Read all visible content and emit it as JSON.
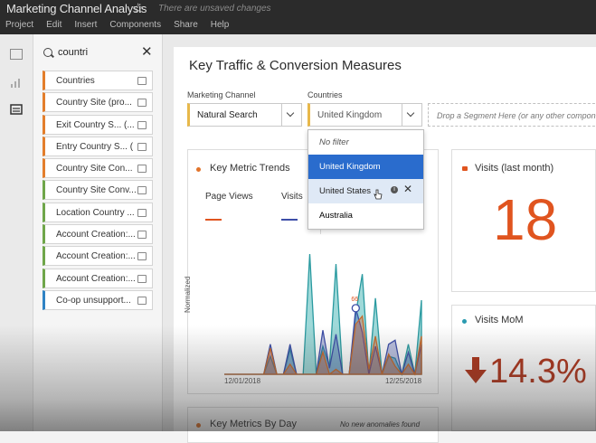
{
  "app": {
    "title": "Marketing Channel Analysis",
    "unsaved": "There are unsaved changes",
    "menu": [
      "Project",
      "Edit",
      "Insert",
      "Components",
      "Share",
      "Help"
    ]
  },
  "components_panel": {
    "search_value": "countri",
    "items": [
      {
        "label": "Countries",
        "color": "orange"
      },
      {
        "label": "Country Site  (pro...",
        "color": "orange"
      },
      {
        "label": "Exit Country S...  (...",
        "color": "orange"
      },
      {
        "label": "Entry Country S...  (",
        "color": "orange"
      },
      {
        "label": "Country Site Con...",
        "color": "orange"
      },
      {
        "label": "Country Site Conv...",
        "color": "green"
      },
      {
        "label": "Location Country ...",
        "color": "green"
      },
      {
        "label": "Account Creation:...",
        "color": "green"
      },
      {
        "label": "Account Creation:...",
        "color": "green"
      },
      {
        "label": "Account Creation:...",
        "color": "green"
      },
      {
        "label": "Co-op unsupport...",
        "color": "blue"
      }
    ]
  },
  "freeform": {
    "title": "Key Traffic & Conversion Measures",
    "filters": [
      {
        "label": "Marketing Channel",
        "value": "Natural Search"
      },
      {
        "label": "Countries",
        "value": "United Kingdom"
      }
    ],
    "segment_drop": "Drop a Segment Here (or any other component"
  },
  "dropdown": {
    "options": [
      "No filter",
      "United Kingdom",
      "United States",
      "Australia"
    ],
    "selected": "United Kingdom",
    "hovered": "United States"
  },
  "trend_card": {
    "title": "Key Metric Trends",
    "legend": [
      "Page Views",
      "Visits"
    ],
    "ylabel": "Normalized",
    "xlabels": [
      "12/01/2018",
      "12/25/2018"
    ],
    "peak_label": "66"
  },
  "visits_card": {
    "title": "Visits (last month)",
    "value": "18"
  },
  "mom_card": {
    "title": "Visits MoM",
    "value": "14.3%"
  },
  "bottom_card": {
    "title": "Key Metrics By Day",
    "note": "No new anomalies found"
  },
  "chart_data": {
    "type": "area",
    "ylabel": "Normalized",
    "x": [
      "12/01/2018",
      "",
      "",
      "",
      "",
      "",
      "",
      "",
      "",
      "",
      "",
      "",
      "",
      "",
      "",
      "",
      "",
      "",
      "",
      "",
      "",
      "",
      "",
      "",
      "12/25/2018",
      "",
      "",
      "",
      "",
      "",
      ""
    ],
    "series": [
      {
        "name": "Page Views",
        "values": [
          0,
          0,
          0,
          0,
          0,
          0,
          0,
          26,
          0,
          0,
          10,
          0,
          0,
          0,
          0,
          22,
          0,
          5,
          0,
          0,
          50,
          58,
          5,
          38,
          0,
          20,
          8,
          0,
          10,
          0,
          38
        ]
      },
      {
        "name": "Visits",
        "values": [
          0,
          0,
          0,
          0,
          0,
          0,
          0,
          30,
          0,
          0,
          30,
          0,
          0,
          0,
          0,
          44,
          6,
          40,
          0,
          0,
          66,
          42,
          0,
          28,
          0,
          30,
          34,
          0,
          22,
          0,
          30
        ]
      },
      {
        "name": "",
        "values": [
          0,
          0,
          0,
          0,
          0,
          0,
          0,
          18,
          0,
          0,
          25,
          0,
          0,
          120,
          0,
          28,
          8,
          110,
          0,
          0,
          60,
          100,
          0,
          76,
          0,
          18,
          16,
          0,
          30,
          0,
          74
        ]
      }
    ]
  }
}
